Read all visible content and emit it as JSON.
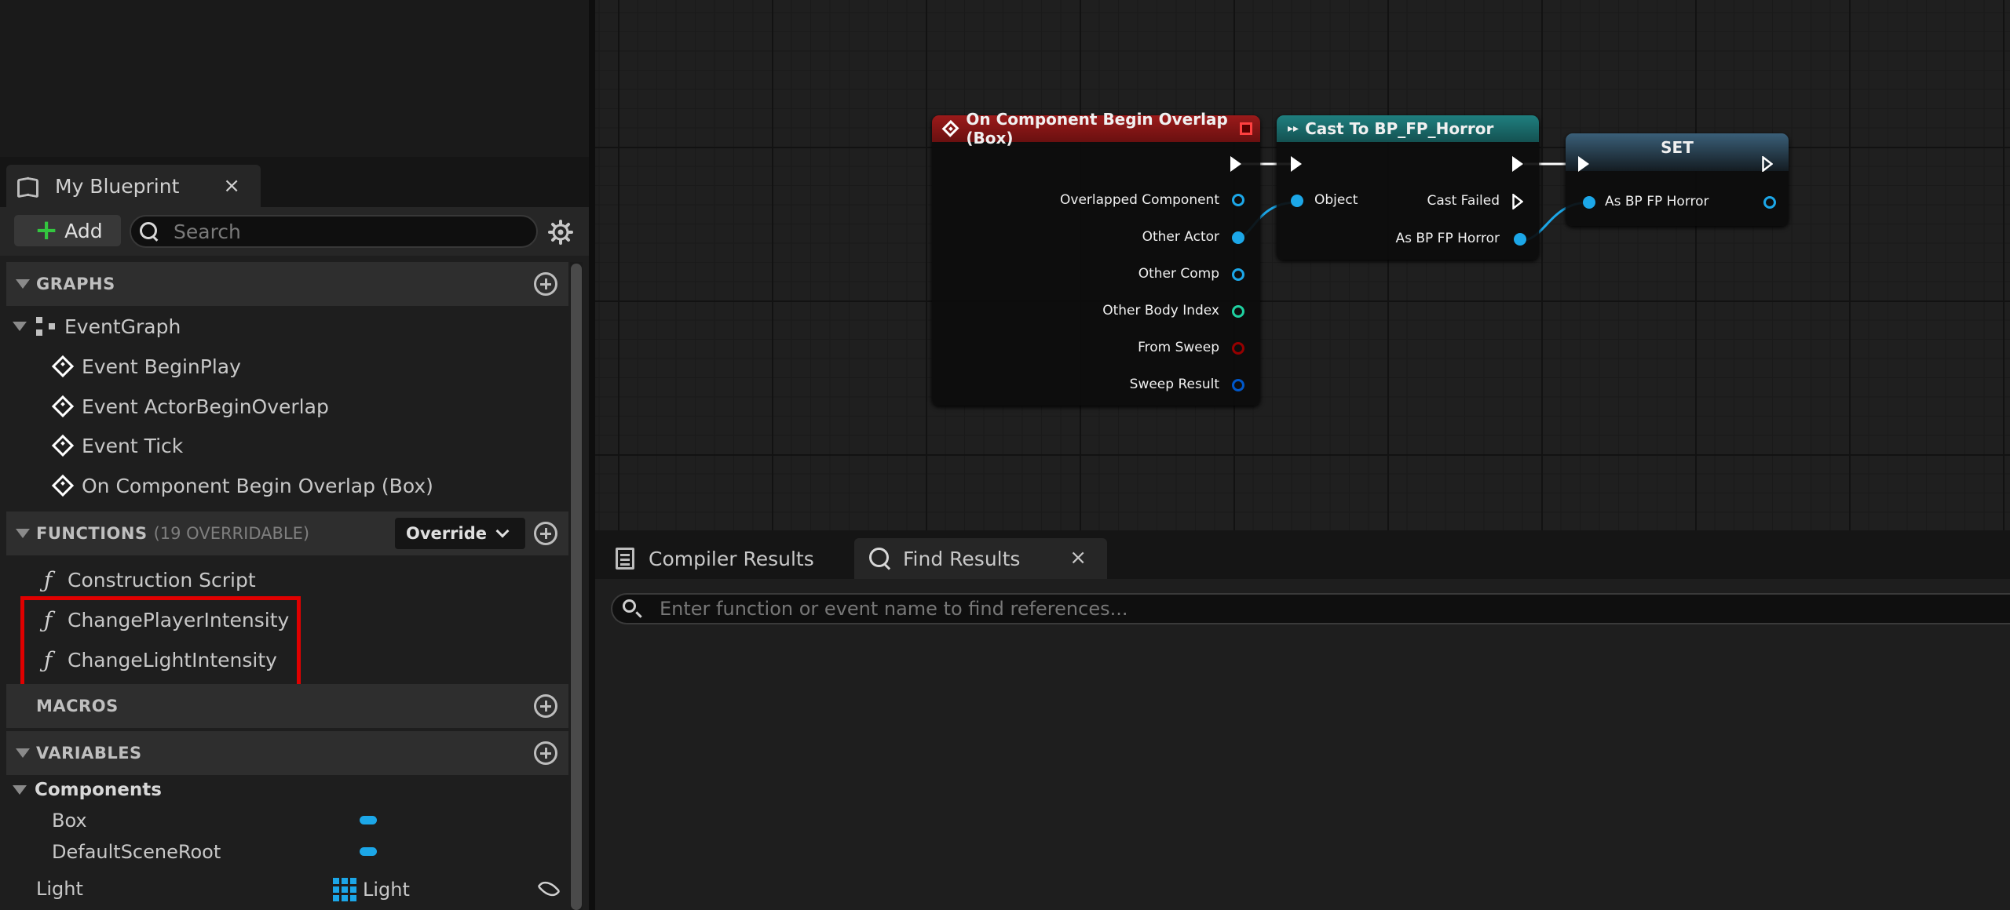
{
  "my_blueprint": {
    "tab_label": "My Blueprint",
    "close_glyph": "×",
    "add_label": "Add",
    "search_placeholder": "Search",
    "sections": {
      "graphs": {
        "title": "GRAPHS"
      },
      "functions": {
        "title": "FUNCTIONS",
        "sub": "(19 OVERRIDABLE)",
        "override_label": "Override"
      },
      "macros": {
        "title": "MACROS"
      },
      "variables": {
        "title": "VARIABLES"
      }
    },
    "graphs": {
      "root": "EventGraph",
      "events": [
        "Event BeginPlay",
        "Event ActorBeginOverlap",
        "Event Tick",
        "On Component Begin Overlap (Box)"
      ]
    },
    "functions": [
      "Construction Script",
      "ChangePlayerIntensity",
      "ChangeLightIntensity"
    ],
    "variables": {
      "category": "Components",
      "items": [
        {
          "name": "Box",
          "type_color": "#1ca7e8"
        },
        {
          "name": "DefaultSceneRoot",
          "type_color": "#1ca7e8"
        }
      ],
      "light": {
        "name": "Light",
        "type": "Light"
      }
    }
  },
  "graph": {
    "nodes": {
      "overlap": {
        "title": "On Component Begin Overlap (Box)",
        "header_color": "#8b1414",
        "pins": [
          "Overlapped Component",
          "Other Actor",
          "Other Comp",
          "Other Body Index",
          "From Sweep",
          "Sweep Result"
        ]
      },
      "cast": {
        "title": "Cast To BP_FP_Horror",
        "header_color": "#1a6e6e",
        "input_pin": "Object",
        "cast_failed": "Cast Failed",
        "output_pin": "As BP FP Horror"
      },
      "set": {
        "title": "SET",
        "header_color": "#2c4a5c",
        "input_pin": "As BP FP Horror"
      }
    },
    "pin_colors": {
      "object": "#1ca7e8",
      "int": "#1fd0a0",
      "bool": "#950000",
      "struct": "#0057c8"
    }
  },
  "bottom_panel": {
    "tabs": [
      "Compiler Results",
      "Find Results"
    ],
    "active_tab": "Find Results",
    "close_glyph": "×",
    "find_placeholder": "Enter function or event name to find references..."
  }
}
